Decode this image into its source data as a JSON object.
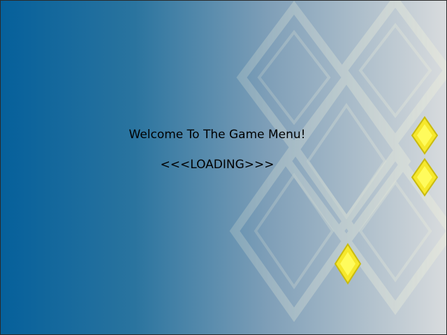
{
  "screen": {
    "title": "Welcome To The Game Menu!",
    "status": "<<<LOADING>>>"
  },
  "colors": {
    "gradient_left": "#06609a",
    "gradient_mid": "#7a9fba",
    "gradient_right": "#d6dadd",
    "pattern_stroke": "#e8ecda",
    "gem_fill": "#fff23a",
    "gem_outline": "#c8b800",
    "text": "#000000"
  }
}
